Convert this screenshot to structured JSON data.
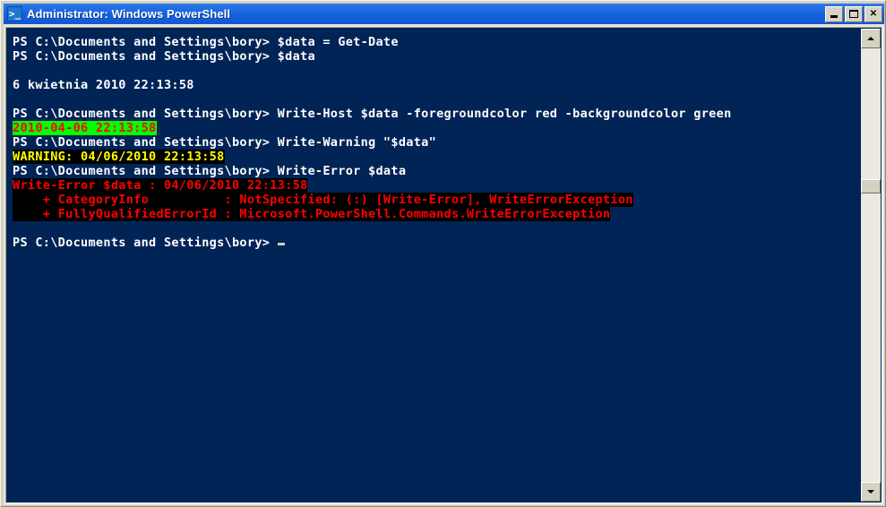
{
  "window": {
    "title": "Administrator: Windows PowerShell",
    "icon": "powershell-prompt-icon",
    "icon_glyph": ">_",
    "buttons": {
      "minimize_label": "Minimize",
      "maximize_label": "Maximize",
      "close_label": "✕"
    },
    "colors": {
      "titlebar": "#1464e0",
      "console_background": "#012456",
      "console_foreground": "#ffffff",
      "frame": "#d6d2c2"
    }
  },
  "console": {
    "prompt": "PS C:\\Documents and Settings\\bory> ",
    "lines": [
      {
        "id": "line-1-command",
        "segments": [
          {
            "text": "PS C:\\Documents and Settings\\bory> $data = Get-Date",
            "style": "c-white"
          }
        ]
      },
      {
        "id": "line-2-command",
        "segments": [
          {
            "text": "PS C:\\Documents and Settings\\bory> $data",
            "style": "c-white"
          }
        ]
      },
      {
        "id": "line-3-blank",
        "segments": []
      },
      {
        "id": "line-4-output-date",
        "segments": [
          {
            "text": "6 kwietnia 2010 22:13:58",
            "style": "c-white"
          }
        ]
      },
      {
        "id": "line-5-blank",
        "segments": []
      },
      {
        "id": "line-6-command-write-host",
        "segments": [
          {
            "text": "PS C:\\Documents and Settings\\bory> Write-Host $data -foregroundcolor red -backgroundcolor green",
            "style": "c-white"
          }
        ]
      },
      {
        "id": "line-7-write-host-output",
        "segments": [
          {
            "text": "2010-04-06 22:13:58",
            "style": "c-red-on-green"
          }
        ]
      },
      {
        "id": "line-8-command-write-warning",
        "segments": [
          {
            "text": "PS C:\\Documents and Settings\\bory> Write-Warning \"$data\"",
            "style": "c-white"
          }
        ]
      },
      {
        "id": "line-9-warning-output",
        "segments": [
          {
            "text": "WARNING: 04/06/2010 22:13:58",
            "style": "c-yellow-on-black"
          }
        ]
      },
      {
        "id": "line-10-command-write-error",
        "segments": [
          {
            "text": "PS C:\\Documents and Settings\\bory> Write-Error $data",
            "style": "c-white"
          }
        ]
      },
      {
        "id": "line-11-error-message",
        "segments": [
          {
            "text": "Write-Error $data : 04/06/2010 22:13:58",
            "style": "c-red-on-black"
          }
        ]
      },
      {
        "id": "line-12-error-categoryinfo",
        "segments": [
          {
            "text": "    + CategoryInfo          : NotSpecified: (:) [Write-Error], WriteErrorException",
            "style": "c-red-on-black"
          }
        ]
      },
      {
        "id": "line-13-error-fqid",
        "segments": [
          {
            "text": "    + FullyQualifiedErrorId : Microsoft.PowerShell.Commands.WriteErrorException",
            "style": "c-red-on-black"
          }
        ]
      },
      {
        "id": "line-14-blank",
        "segments": []
      },
      {
        "id": "line-15-prompt",
        "segments": [
          {
            "text": "PS C:\\Documents and Settings\\bory> ",
            "style": "c-white"
          }
        ],
        "cursor": true
      }
    ]
  },
  "scrollbar": {
    "up_arrow": "scroll-up-arrow-icon",
    "down_arrow": "scroll-down-arrow-icon",
    "thumb_label": "vertical-scroll-thumb"
  }
}
